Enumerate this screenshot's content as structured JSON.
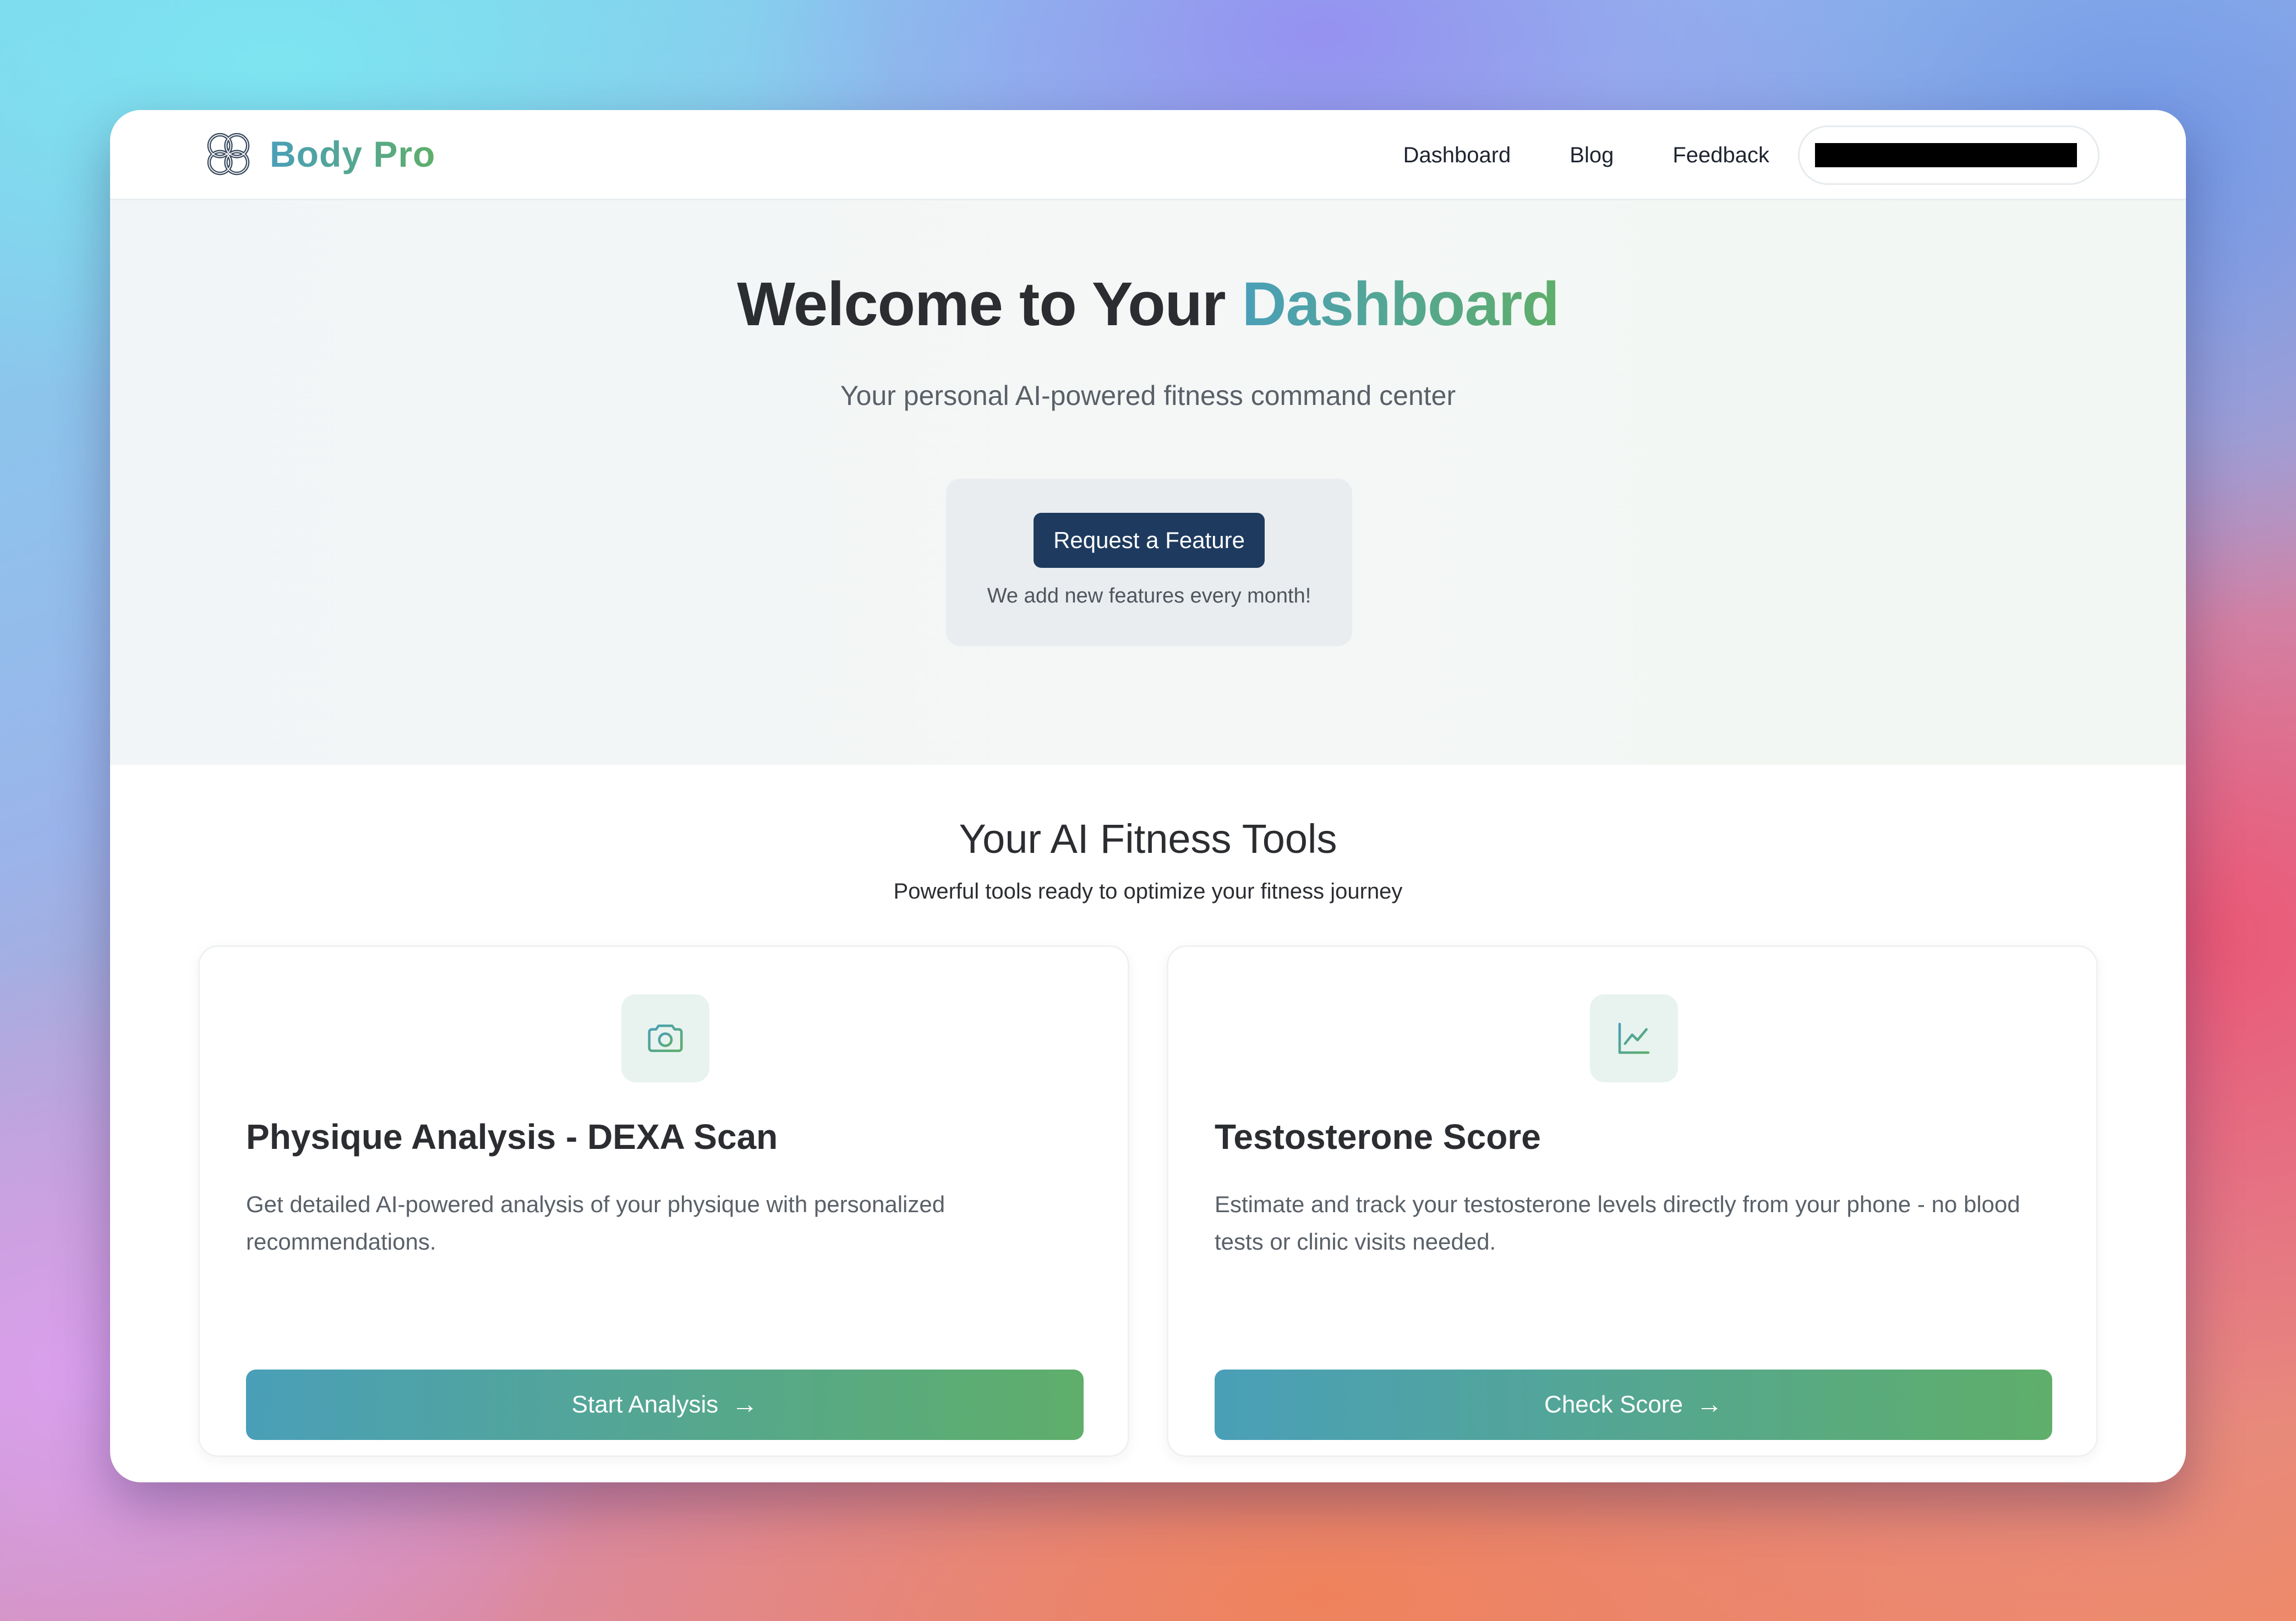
{
  "brand": {
    "name": "Body Pro",
    "logo_icon": "knot-logo-icon"
  },
  "nav": {
    "links": [
      "Dashboard",
      "Blog",
      "Feedback"
    ],
    "account": {
      "redacted": true
    }
  },
  "hero": {
    "title_prefix": "Welcome to Your ",
    "title_accent": "Dashboard",
    "subtitle": "Your personal AI-powered fitness command center",
    "feature_button": "Request a Feature",
    "feature_note": "We add new features every month!"
  },
  "tools": {
    "title": "Your AI Fitness Tools",
    "subtitle": "Powerful tools ready to optimize your fitness journey",
    "cards": [
      {
        "icon": "camera-icon",
        "title": "Physique Analysis - DEXA Scan",
        "description": "Get detailed AI-powered analysis of your physique with personalized recommendations.",
        "button": "Start Analysis",
        "button_icon": "→"
      },
      {
        "icon": "line-chart-icon",
        "title": "Testosterone Score",
        "description": "Estimate and track your testosterone levels directly from your phone - no blood tests or clinic visits needed.",
        "button": "Check Score",
        "button_icon": "→"
      }
    ]
  },
  "colors": {
    "brand_gradient_start": "#4a9fb8",
    "brand_gradient_end": "#5fae6a",
    "feature_button": "#1e3a5f",
    "text_dark": "#2b2d31",
    "text_muted": "#5a6068"
  }
}
